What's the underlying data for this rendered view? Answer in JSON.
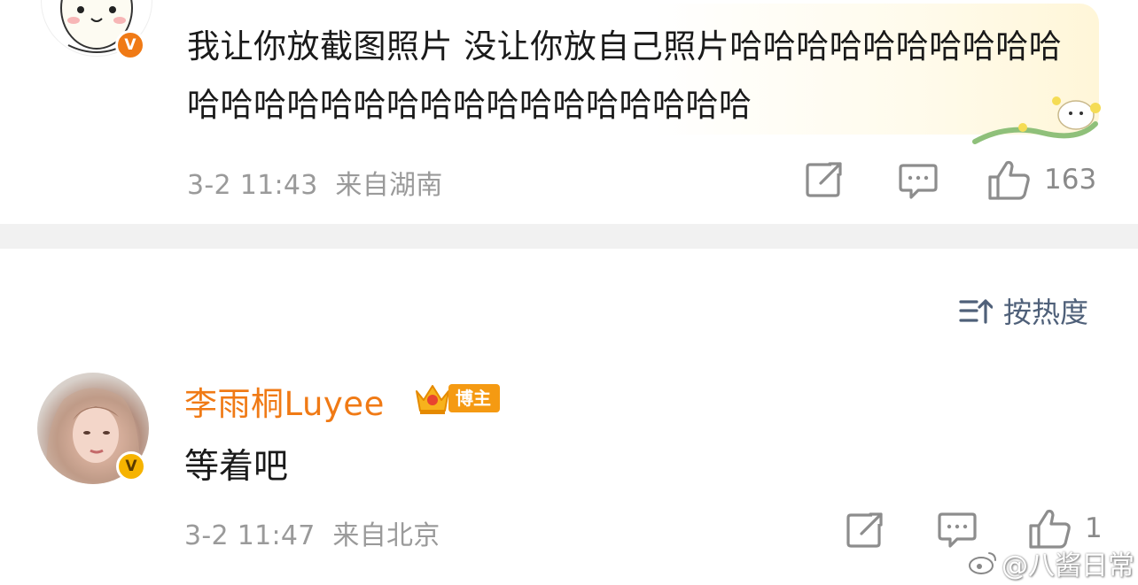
{
  "comment1": {
    "text": "我让你放截图照片 没让你放自己照片哈哈哈哈哈哈哈哈哈哈哈哈哈哈哈哈哈哈哈哈哈哈哈哈哈哈哈",
    "date": "3-2 11:43",
    "location": "来自湖南",
    "like_count": "163",
    "verified_badge": "V"
  },
  "sort": {
    "label": "按热度"
  },
  "comment2": {
    "username": "李雨桐Luyee",
    "role_badge": "博主",
    "text": "等着吧",
    "date": "3-2 11:47",
    "location": "来自北京",
    "like_count": "1",
    "verified_badge": "V"
  },
  "watermark": {
    "text": "@八酱日常"
  },
  "colors": {
    "accent_orange": "#f07a15",
    "sort_blue": "#4f6079",
    "meta_gray": "#9a9a9a",
    "badge_yellow": "#f6b300"
  },
  "icons": [
    "share-icon",
    "comment-icon",
    "like-icon",
    "sort-icon",
    "crown-icon",
    "weibo-logo-icon"
  ]
}
